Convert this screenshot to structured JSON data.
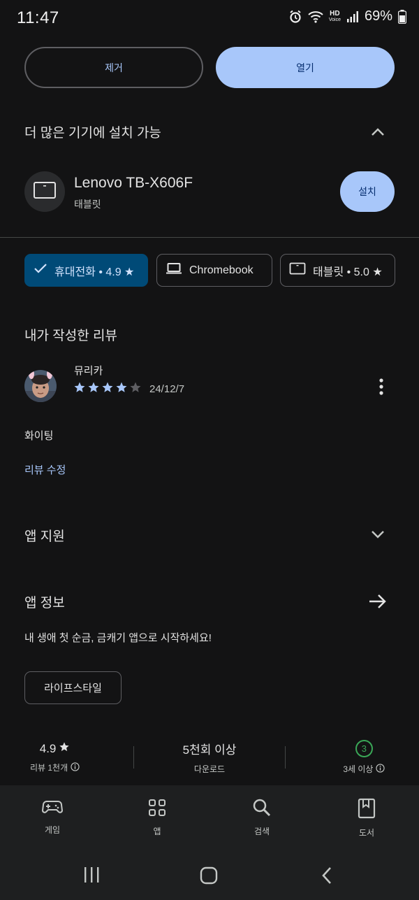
{
  "status_bar": {
    "time": "11:47",
    "hd_top": "HD",
    "hd_bottom": "Voice",
    "battery": "69%",
    "icons": [
      "alarm-icon",
      "wifi-icon",
      "hd-voice-icon",
      "signal-icon",
      "battery-icon"
    ]
  },
  "actions": {
    "remove_label": "제거",
    "open_label": "열기"
  },
  "more_devices": {
    "title": "더 많은 기기에 설치 가능",
    "device_name": "Lenovo TB-X606F",
    "device_type": "태블릿",
    "install_label": "설치"
  },
  "device_chips": [
    {
      "label": "휴대전화 • 4.9 ★",
      "icon": "check-icon",
      "selected": true
    },
    {
      "label": "Chromebook",
      "icon": "laptop-icon",
      "selected": false
    },
    {
      "label": "태블릿 • 5.0 ★",
      "icon": "tablet-icon",
      "selected": false
    }
  ],
  "my_review": {
    "title": "내가 작성한 리뷰",
    "reviewer": "뮤리카",
    "rating": 4,
    "date": "24/12/7",
    "text": "화이팅",
    "edit_label": "리뷰 수정"
  },
  "app_support": {
    "title": "앱 지원"
  },
  "app_info": {
    "title": "앱 정보",
    "description": "내 생애 첫 순금, 금캐기 앱으로 시작하세요!",
    "category": "라이프스타일"
  },
  "stats": {
    "rating_value": "4.9",
    "rating_label": "리뷰 1천개",
    "downloads_value": "5천회 이상",
    "downloads_label": "다운로드",
    "age_badge": "3",
    "age_label": "3세 이상"
  },
  "bottom_nav": [
    {
      "label": "게임",
      "icon": "gamepad-icon"
    },
    {
      "label": "앱",
      "icon": "apps-grid-icon"
    },
    {
      "label": "검색",
      "icon": "search-icon"
    },
    {
      "label": "도서",
      "icon": "book-icon"
    }
  ],
  "colors": {
    "background": "#131314",
    "accent": "#a8c7fa",
    "selected_chip": "#004a77",
    "star": "#a8c7fa"
  }
}
